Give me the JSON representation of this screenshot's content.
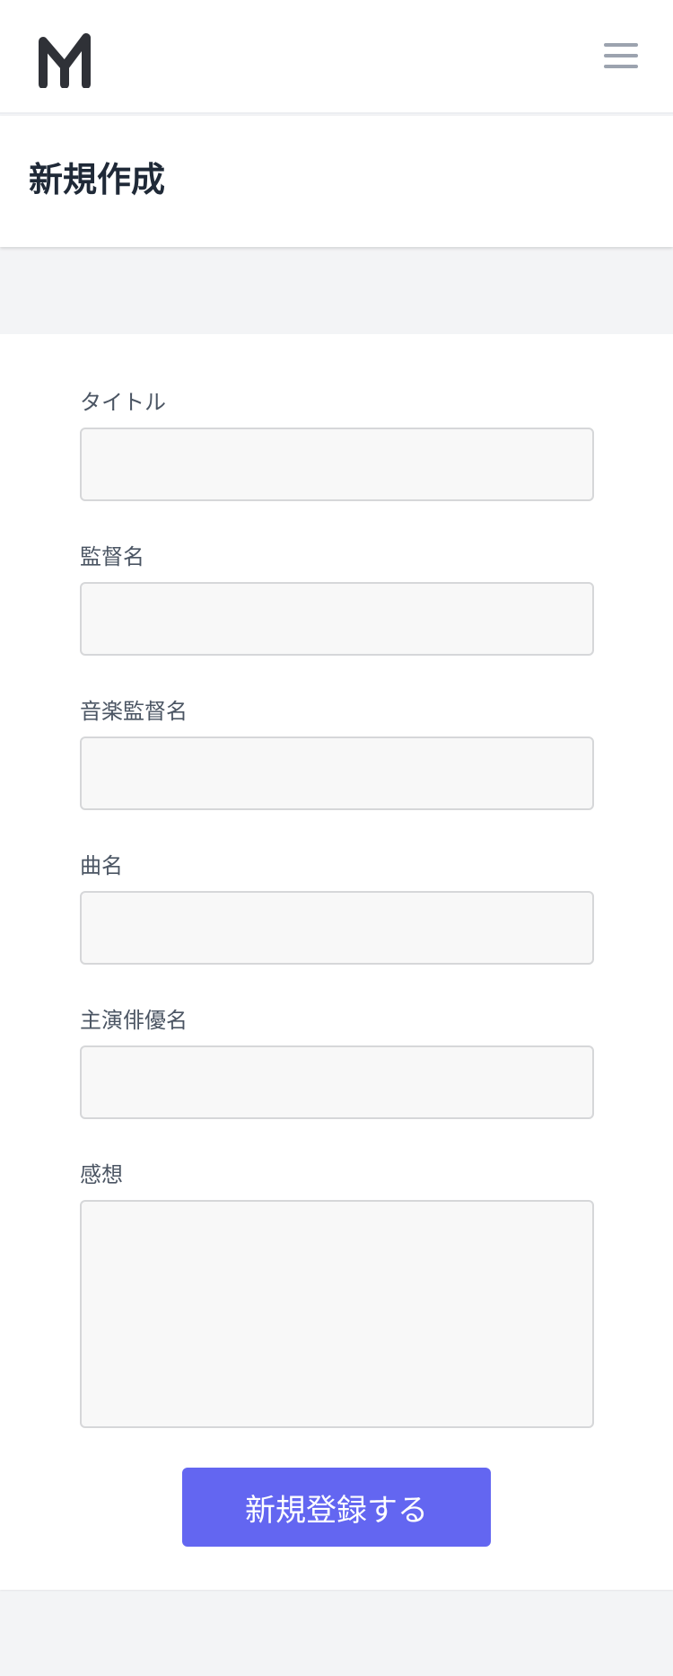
{
  "nav": {
    "logo_icon": "m-logo-icon",
    "menu_icon": "hamburger-menu-icon"
  },
  "header": {
    "title": "新規作成"
  },
  "form": {
    "fields": [
      {
        "label": "タイトル",
        "value": "",
        "placeholder": ""
      },
      {
        "label": "監督名",
        "value": "",
        "placeholder": ""
      },
      {
        "label": "音楽監督名",
        "value": "",
        "placeholder": ""
      },
      {
        "label": "曲名",
        "value": "",
        "placeholder": ""
      },
      {
        "label": "主演俳優名",
        "value": "",
        "placeholder": ""
      },
      {
        "label": "感想",
        "value": "",
        "placeholder": ""
      }
    ],
    "submit_label": "新規登録する"
  },
  "colors": {
    "accent": "#6366f1",
    "logo": "#2f3137",
    "menu_icon": "#9ca3af",
    "page_bg": "#f3f4f6",
    "title_text": "#1f2937"
  }
}
